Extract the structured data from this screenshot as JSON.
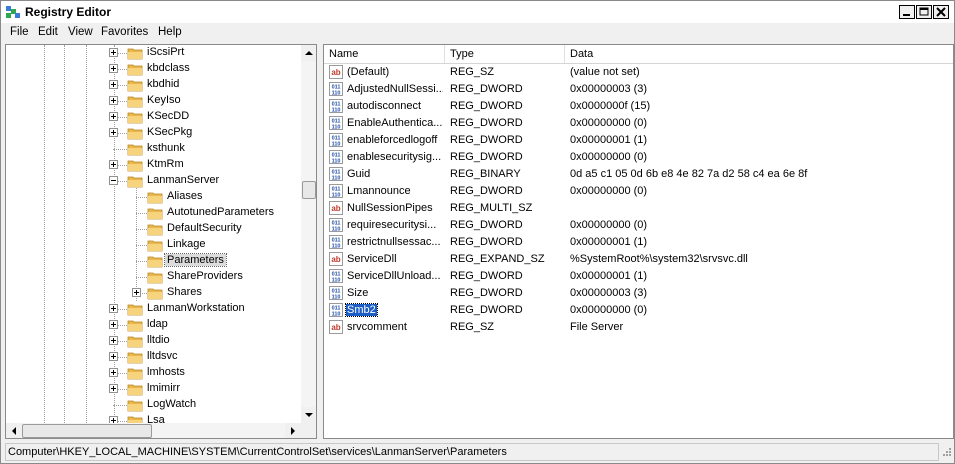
{
  "window": {
    "title": "Registry Editor"
  },
  "menu": [
    "File",
    "Edit",
    "View",
    "Favorites",
    "Help"
  ],
  "tree": [
    {
      "label": "iScsiPrt",
      "level": 1,
      "expander": "plus"
    },
    {
      "label": "kbdclass",
      "level": 1,
      "expander": "plus"
    },
    {
      "label": "kbdhid",
      "level": 1,
      "expander": "plus"
    },
    {
      "label": "KeyIso",
      "level": 1,
      "expander": "plus"
    },
    {
      "label": "KSecDD",
      "level": 1,
      "expander": "plus"
    },
    {
      "label": "KSecPkg",
      "level": 1,
      "expander": "plus"
    },
    {
      "label": "ksthunk",
      "level": 1,
      "expander": "none"
    },
    {
      "label": "KtmRm",
      "level": 1,
      "expander": "plus"
    },
    {
      "label": "LanmanServer",
      "level": 1,
      "expander": "minus"
    },
    {
      "label": "Aliases",
      "level": 2,
      "expander": "none"
    },
    {
      "label": "AutotunedParameters",
      "level": 2,
      "expander": "none"
    },
    {
      "label": "DefaultSecurity",
      "level": 2,
      "expander": "none"
    },
    {
      "label": "Linkage",
      "level": 2,
      "expander": "none"
    },
    {
      "label": "Parameters",
      "level": 2,
      "expander": "none",
      "selected": true
    },
    {
      "label": "ShareProviders",
      "level": 2,
      "expander": "none"
    },
    {
      "label": "Shares",
      "level": 2,
      "expander": "plus"
    },
    {
      "label": "LanmanWorkstation",
      "level": 1,
      "expander": "plus"
    },
    {
      "label": "ldap",
      "level": 1,
      "expander": "plus"
    },
    {
      "label": "lltdio",
      "level": 1,
      "expander": "plus"
    },
    {
      "label": "lltdsvc",
      "level": 1,
      "expander": "plus"
    },
    {
      "label": "lmhosts",
      "level": 1,
      "expander": "plus"
    },
    {
      "label": "lmimirr",
      "level": 1,
      "expander": "plus"
    },
    {
      "label": "LogWatch",
      "level": 1,
      "expander": "none"
    },
    {
      "label": "Lsa",
      "level": 1,
      "expander": "plus"
    }
  ],
  "list": {
    "columns": [
      "Name",
      "Type",
      "Data"
    ],
    "rows": [
      {
        "icon": "ab",
        "name": "(Default)",
        "type": "REG_SZ",
        "data": "(value not set)"
      },
      {
        "icon": "bin",
        "name": "AdjustedNullSessi...",
        "type": "REG_DWORD",
        "data": "0x00000003 (3)"
      },
      {
        "icon": "bin",
        "name": "autodisconnect",
        "type": "REG_DWORD",
        "data": "0x0000000f (15)"
      },
      {
        "icon": "bin",
        "name": "EnableAuthentica...",
        "type": "REG_DWORD",
        "data": "0x00000000 (0)"
      },
      {
        "icon": "bin",
        "name": "enableforcedlogoff",
        "type": "REG_DWORD",
        "data": "0x00000001 (1)"
      },
      {
        "icon": "bin",
        "name": "enablesecuritysig...",
        "type": "REG_DWORD",
        "data": "0x00000000 (0)"
      },
      {
        "icon": "bin",
        "name": "Guid",
        "type": "REG_BINARY",
        "data": "0d a5 c1 05 0d 6b e8 4e 82 7a d2 58 c4 ea 6e 8f"
      },
      {
        "icon": "bin",
        "name": "Lmannounce",
        "type": "REG_DWORD",
        "data": "0x00000000 (0)"
      },
      {
        "icon": "ab",
        "name": "NullSessionPipes",
        "type": "REG_MULTI_SZ",
        "data": ""
      },
      {
        "icon": "bin",
        "name": "requiresecuritysi...",
        "type": "REG_DWORD",
        "data": "0x00000000 (0)"
      },
      {
        "icon": "bin",
        "name": "restrictnullsessac...",
        "type": "REG_DWORD",
        "data": "0x00000001 (1)"
      },
      {
        "icon": "ab",
        "name": "ServiceDll",
        "type": "REG_EXPAND_SZ",
        "data": "%SystemRoot%\\system32\\srvsvc.dll"
      },
      {
        "icon": "bin",
        "name": "ServiceDllUnload...",
        "type": "REG_DWORD",
        "data": "0x00000001 (1)"
      },
      {
        "icon": "bin",
        "name": "Size",
        "type": "REG_DWORD",
        "data": "0x00000003 (3)"
      },
      {
        "icon": "bin",
        "name": "Smb2",
        "type": "REG_DWORD",
        "data": "0x00000000 (0)",
        "selected": true
      },
      {
        "icon": "ab",
        "name": "srvcomment",
        "type": "REG_SZ",
        "data": "File Server"
      }
    ]
  },
  "status": {
    "path": "Computer\\HKEY_LOCAL_MACHINE\\SYSTEM\\CurrentControlSet\\services\\LanmanServer\\Parameters"
  },
  "colors": {
    "selection": "#1c5ec6",
    "folder": "#e8b94a",
    "reg_string_icon": "#c0392b",
    "reg_binary_icon": "#1f4fa8"
  }
}
